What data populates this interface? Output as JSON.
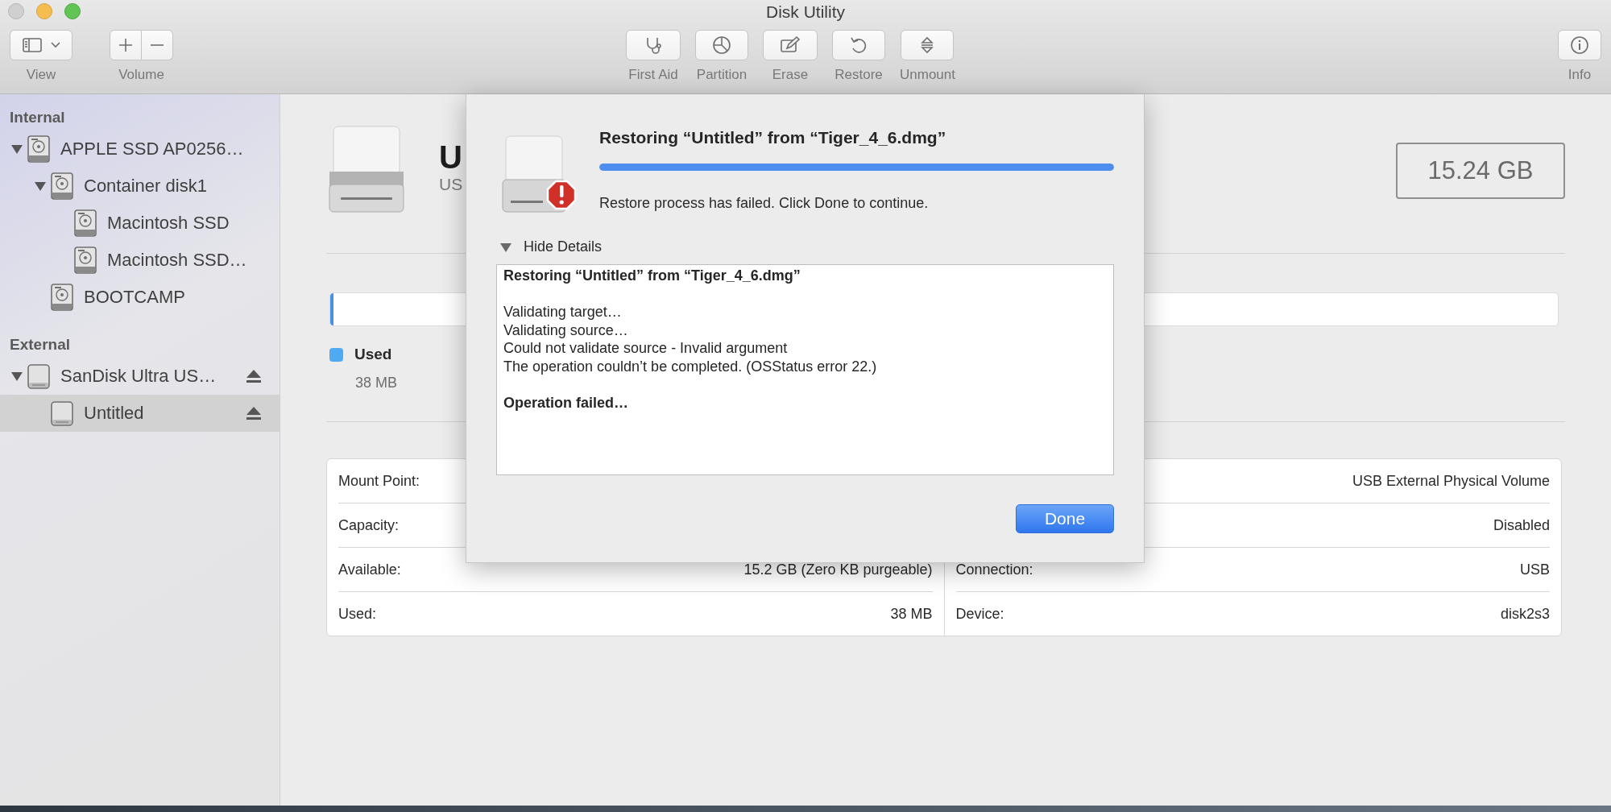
{
  "window": {
    "title": "Disk Utility"
  },
  "toolbar": {
    "left": [
      {
        "label": "View"
      },
      {
        "label": "Volume"
      }
    ],
    "center": [
      {
        "label": "First Aid"
      },
      {
        "label": "Partition"
      },
      {
        "label": "Erase"
      },
      {
        "label": "Restore"
      },
      {
        "label": "Unmount"
      }
    ],
    "right": [
      {
        "label": "Info"
      }
    ]
  },
  "sidebar": {
    "sections": [
      {
        "title": "Internal",
        "items": [
          {
            "label": "APPLE SSD AP0256…",
            "kind": "internal",
            "expanded": true,
            "selected": false,
            "ejectable": false,
            "children": [
              {
                "label": "Container disk1",
                "kind": "internal",
                "expanded": true,
                "selected": false,
                "ejectable": false,
                "children": [
                  {
                    "label": "Macintosh SSD",
                    "kind": "internal",
                    "selected": false,
                    "ejectable": false
                  },
                  {
                    "label": "Macintosh SSD…",
                    "kind": "internal",
                    "selected": false,
                    "ejectable": false
                  }
                ]
              },
              {
                "label": "BOOTCAMP",
                "kind": "internal",
                "selected": false,
                "ejectable": false
              }
            ]
          }
        ]
      },
      {
        "title": "External",
        "items": [
          {
            "label": "SanDisk Ultra US…",
            "kind": "external",
            "expanded": true,
            "selected": false,
            "ejectable": true,
            "children": [
              {
                "label": "Untitled",
                "kind": "external",
                "selected": true,
                "ejectable": true
              }
            ]
          }
        ]
      }
    ]
  },
  "volume": {
    "name": "U",
    "subtitle": "US",
    "capacity": "15.24 GB",
    "usage": {
      "label": "Used",
      "value": "38 MB",
      "level": 0.0025
    }
  },
  "info": {
    "left": [
      {
        "label": "Mount Point:"
      },
      {
        "label": "Capacity:"
      },
      {
        "label": "Available:",
        "value": "15.2 GB (Zero KB purgeable)"
      },
      {
        "label": "Used:",
        "value": "38 MB"
      }
    ],
    "right": [
      {
        "value": "USB External Physical Volume"
      },
      {
        "value": "Disabled"
      },
      {
        "label": "Connection:",
        "value": "USB"
      },
      {
        "label": "Device:",
        "value": "disk2s3"
      }
    ]
  },
  "dialog": {
    "title": "Restoring “Untitled” from “Tiger_4_6.dmg”",
    "level": 1,
    "message": "Restore process has failed. Click Done to continue.",
    "details_toggle": {
      "label": "Hide Details",
      "expanded": true
    },
    "details": [
      {
        "kind": "bold",
        "lines": [
          "Restoring “Untitled” from “Tiger_4_6.dmg”"
        ]
      },
      {
        "kind": "plain",
        "lines": [
          "Validating target…",
          "Validating source…",
          "Could not validate source - Invalid argument",
          "The operation couldn’t be completed. (OSStatus error 22.)"
        ]
      },
      {
        "kind": "bold",
        "lines": [
          "Operation failed…"
        ]
      }
    ],
    "button": "Done"
  }
}
